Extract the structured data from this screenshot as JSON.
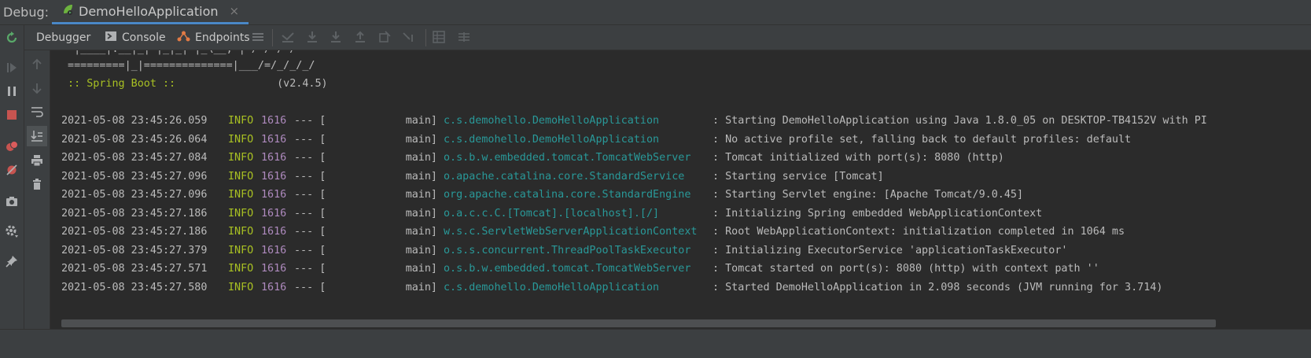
{
  "header": {
    "debug_label": "Debug:",
    "run_tab": "DemoHelloApplication",
    "close_glyph": "×"
  },
  "toolbar": {
    "debugger": "Debugger",
    "console": "Console",
    "endpoints": "Endpoints"
  },
  "colors": {
    "accent": "#4a88c7",
    "spring_green": "#a8c023",
    "logger_teal": "#299999",
    "pid_purple": "#ae8abe"
  },
  "console": {
    "banner_line1": "  |____|.__|_| |_|_| |_\\__, | / / / /",
    "banner_line2": " =========|_|==============|___/=/_/_/_/",
    "spring_label": " :: Spring Boot :: ",
    "spring_version": "               (v2.4.5)",
    "log_rows": [
      {
        "date": "2021-05-08 23:45:26.059",
        "level": "INFO",
        "pid": "1616",
        "sep": "--- [",
        "thread": "main]",
        "logger": "c.s.demohello.DemoHelloApplication",
        "msg": ": Starting DemoHelloApplication using Java 1.8.0_05 on DESKTOP-TB4152V with PI"
      },
      {
        "date": "2021-05-08 23:45:26.064",
        "level": "INFO",
        "pid": "1616",
        "sep": "--- [",
        "thread": "main]",
        "logger": "c.s.demohello.DemoHelloApplication",
        "msg": ": No active profile set, falling back to default profiles: default"
      },
      {
        "date": "2021-05-08 23:45:27.084",
        "level": "INFO",
        "pid": "1616",
        "sep": "--- [",
        "thread": "main]",
        "logger": "o.s.b.w.embedded.tomcat.TomcatWebServer",
        "msg": ": Tomcat initialized with port(s): 8080 (http)"
      },
      {
        "date": "2021-05-08 23:45:27.096",
        "level": "INFO",
        "pid": "1616",
        "sep": "--- [",
        "thread": "main]",
        "logger": "o.apache.catalina.core.StandardService",
        "msg": ": Starting service [Tomcat]"
      },
      {
        "date": "2021-05-08 23:45:27.096",
        "level": "INFO",
        "pid": "1616",
        "sep": "--- [",
        "thread": "main]",
        "logger": "org.apache.catalina.core.StandardEngine",
        "msg": ": Starting Servlet engine: [Apache Tomcat/9.0.45]"
      },
      {
        "date": "2021-05-08 23:45:27.186",
        "level": "INFO",
        "pid": "1616",
        "sep": "--- [",
        "thread": "main]",
        "logger": "o.a.c.c.C.[Tomcat].[localhost].[/]",
        "msg": ": Initializing Spring embedded WebApplicationContext"
      },
      {
        "date": "2021-05-08 23:45:27.186",
        "level": "INFO",
        "pid": "1616",
        "sep": "--- [",
        "thread": "main]",
        "logger": "w.s.c.ServletWebServerApplicationContext",
        "msg": ": Root WebApplicationContext: initialization completed in 1064 ms"
      },
      {
        "date": "2021-05-08 23:45:27.379",
        "level": "INFO",
        "pid": "1616",
        "sep": "--- [",
        "thread": "main]",
        "logger": "o.s.s.concurrent.ThreadPoolTaskExecutor",
        "msg": ": Initializing ExecutorService 'applicationTaskExecutor'"
      },
      {
        "date": "2021-05-08 23:45:27.571",
        "level": "INFO",
        "pid": "1616",
        "sep": "--- [",
        "thread": "main]",
        "logger": "o.s.b.w.embedded.tomcat.TomcatWebServer",
        "msg": ": Tomcat started on port(s): 8080 (http) with context path ''"
      },
      {
        "date": "2021-05-08 23:45:27.580",
        "level": "INFO",
        "pid": "1616",
        "sep": "--- [",
        "thread": "main]",
        "logger": "c.s.demohello.DemoHelloApplication",
        "msg": ": Started DemoHelloApplication in 2.098 seconds (JVM running for 3.714)"
      }
    ]
  },
  "icons": {
    "rerun": "rerun-icon",
    "resume": "resume-icon",
    "pause": "pause-icon",
    "stop": "stop-icon",
    "breakpoints": "view-breakpoints-icon",
    "mute": "mute-breakpoints-icon",
    "camera": "camera-icon",
    "settings": "settings-icon",
    "pin": "pin-icon"
  }
}
